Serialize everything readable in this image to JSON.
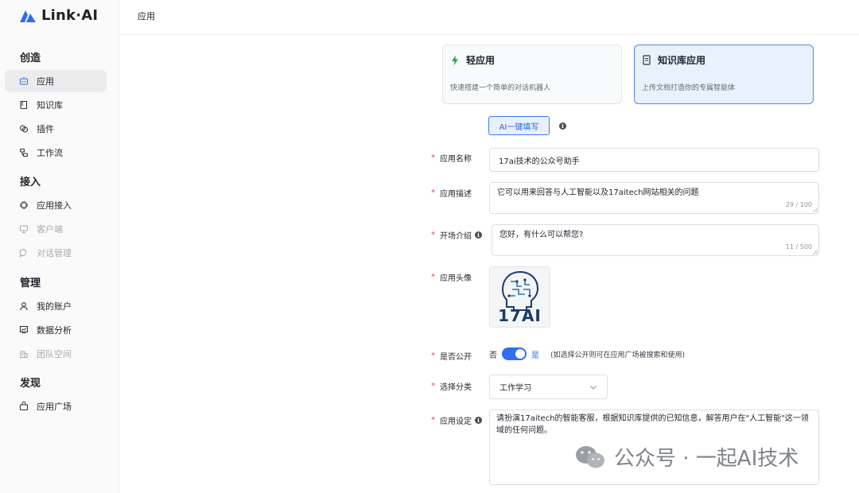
{
  "brand": {
    "name": "Link·AI"
  },
  "sidebar": {
    "sections": [
      {
        "title": "创造",
        "items": [
          {
            "label": "应用",
            "icon": "robot-icon"
          },
          {
            "label": "知识库",
            "icon": "book-icon"
          },
          {
            "label": "插件",
            "icon": "plugin-icon"
          },
          {
            "label": "工作流",
            "icon": "workflow-icon"
          }
        ]
      },
      {
        "title": "接入",
        "items": [
          {
            "label": "应用接入",
            "icon": "chip-icon"
          },
          {
            "label": "客户端",
            "icon": "monitor-icon"
          },
          {
            "label": "对话管理",
            "icon": "chat-icon"
          }
        ]
      },
      {
        "title": "管理",
        "items": [
          {
            "label": "我的账户",
            "icon": "user-icon"
          },
          {
            "label": "数据分析",
            "icon": "chart-icon"
          },
          {
            "label": "团队空间",
            "icon": "building-icon"
          }
        ]
      },
      {
        "title": "发现",
        "items": [
          {
            "label": "应用广场",
            "icon": "store-icon"
          }
        ]
      }
    ]
  },
  "header": {
    "title": "应用"
  },
  "app_types": [
    {
      "title": "轻应用",
      "desc": "快速搭建一个简单的对话机器人",
      "icon": "lightning-icon",
      "selected": false
    },
    {
      "title": "知识库应用",
      "desc": "上传文档打造你的专属智能体",
      "icon": "document-icon",
      "selected": true
    }
  ],
  "ai_fill_label": "AI一键填写",
  "form": {
    "name": {
      "label": "应用名称",
      "value": "17ai技术的公众号助手"
    },
    "desc": {
      "label": "应用描述",
      "value": "它可以用来回答与人工智能以及17aitech网站相关的问题",
      "counter": "29 / 100"
    },
    "intro": {
      "label": "开场介绍",
      "value": "您好，有什么可以帮您?",
      "counter": "11 / 500"
    },
    "avatar": {
      "label": "应用头像",
      "text": "17AI"
    },
    "public": {
      "label": "是否公开",
      "off": "否",
      "on": "是",
      "hint": "(如选择公开则可在应用广场被搜索和使用)"
    },
    "category": {
      "label": "选择分类",
      "value": "工作学习"
    },
    "setting": {
      "label": "应用设定",
      "value": "请扮演17aitech的智能客服，根据知识库提供的已知信息，解答用户在\"人工智能\"这一领域的任何问题。"
    }
  },
  "watermark": {
    "text": "公众号 · 一起AI技术"
  },
  "colors": {
    "accent": "#2f6df1",
    "required": "#e5484d"
  }
}
